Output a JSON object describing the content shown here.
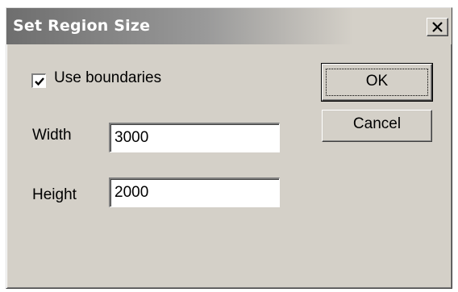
{
  "window": {
    "title": "Set Region Size",
    "close_icon": "close-icon"
  },
  "options": {
    "use_boundaries_label": "Use boundaries",
    "use_boundaries_checked": true
  },
  "fields": {
    "width_label": "Width",
    "width_value": "3000",
    "height_label": "Height",
    "height_value": "2000"
  },
  "buttons": {
    "ok_label": "OK",
    "cancel_label": "Cancel"
  },
  "colors": {
    "dialog_face": "#d4d0c8",
    "titlebar_start": "#6e6e6e",
    "titlebar_text": "#ffffff"
  }
}
